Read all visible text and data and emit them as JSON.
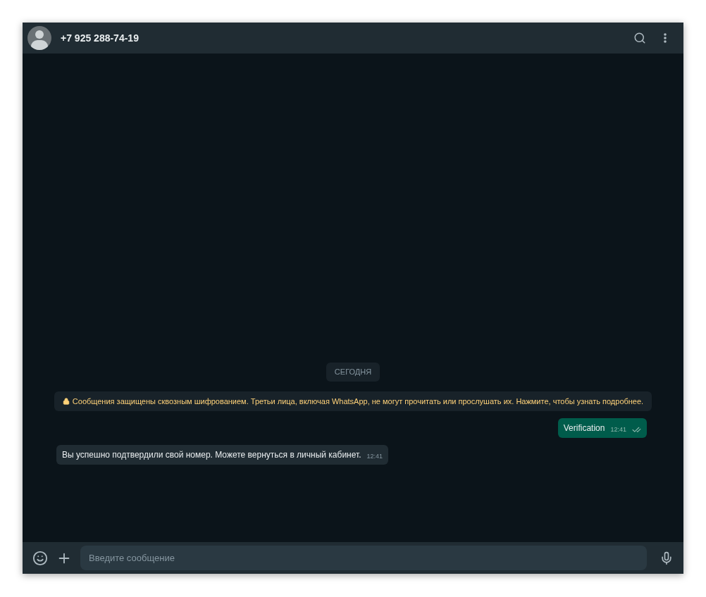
{
  "header": {
    "contact": "+7 925 288-74-19"
  },
  "messages": [
    {
      "kind": "date",
      "text": "СЕГОДНЯ"
    },
    {
      "kind": "system",
      "text": "Сообщения защищены сквозным шифрованием. Третьи лица, включая WhatsApp, не могут прочитать или прослушать их. Нажмите, чтобы узнать подробнее."
    },
    {
      "kind": "outgoing",
      "text": "Verification",
      "time": "12:41"
    },
    {
      "kind": "incoming",
      "text": "Вы успешно подтвердили свой номер. Можете вернуться в личный кабинет.",
      "time": "12:41"
    }
  ],
  "composer": {
    "placeholder": "Введите сообщение"
  }
}
